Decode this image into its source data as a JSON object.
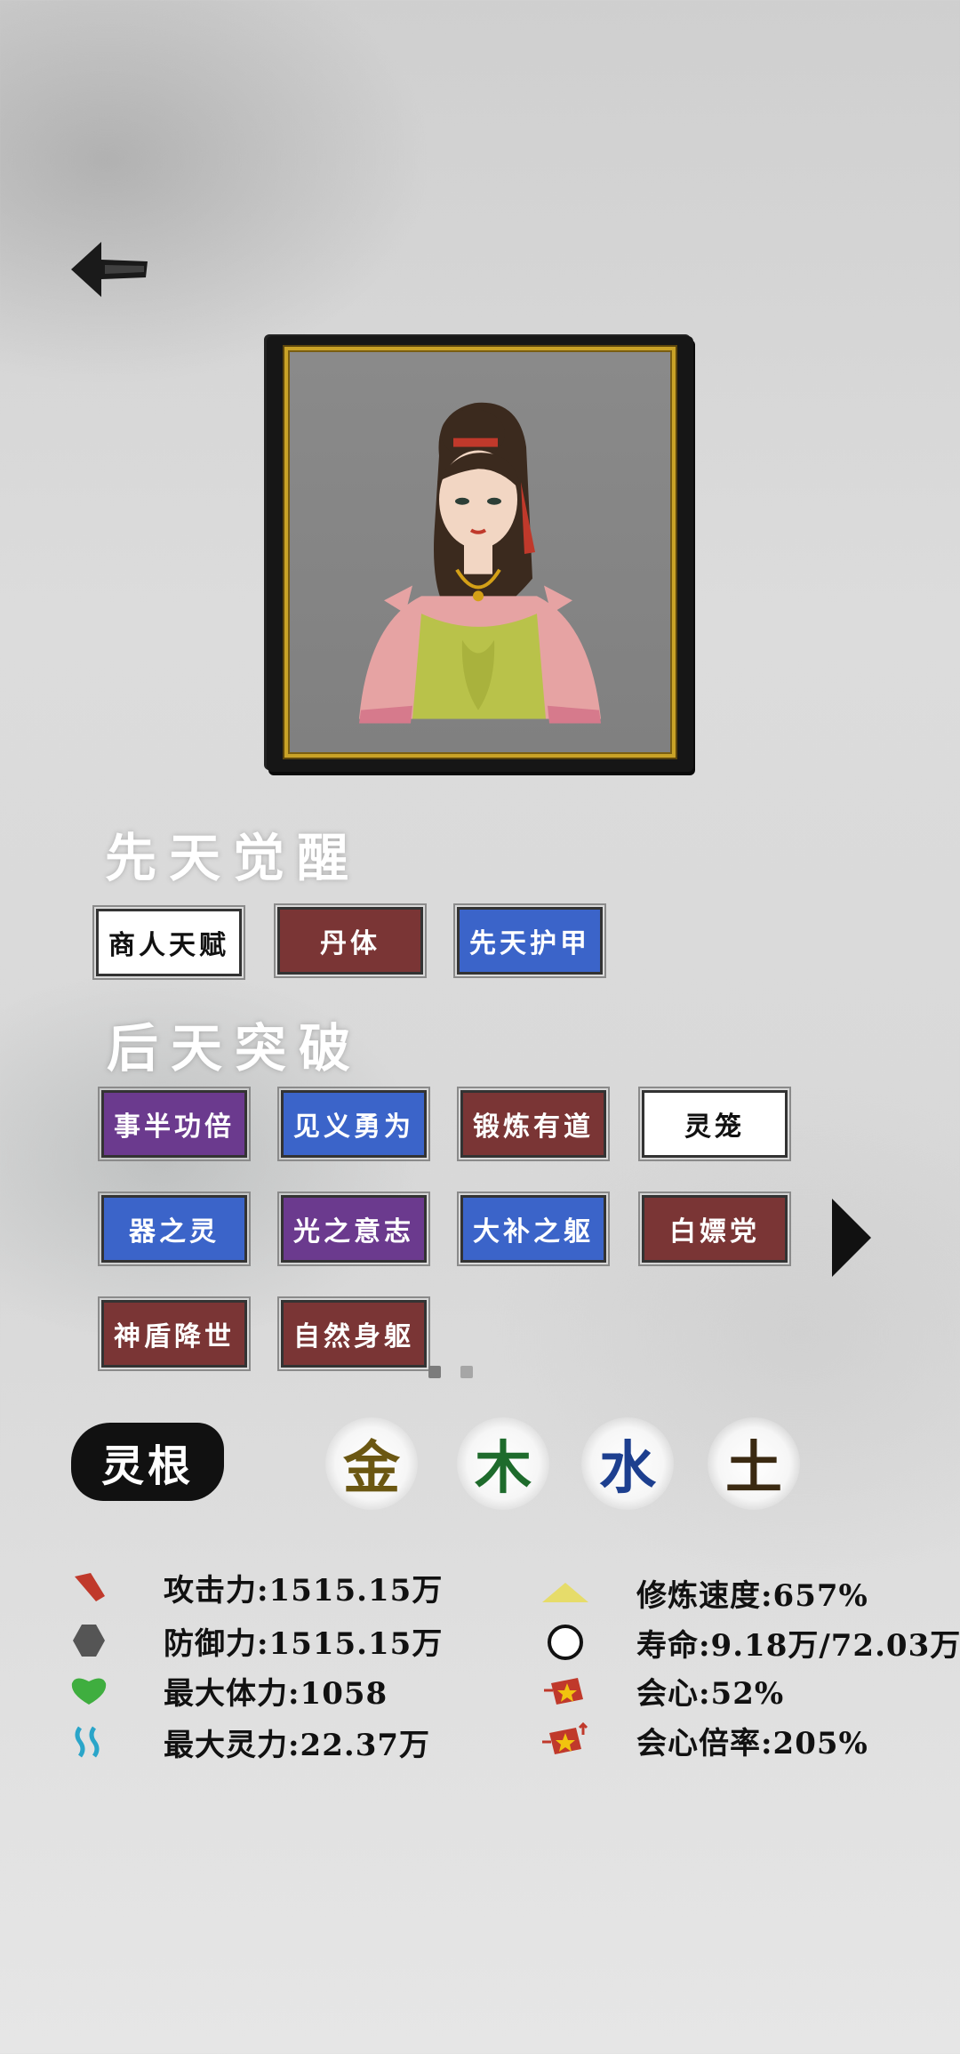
{
  "header": {
    "back_icon": "arrow-left-icon"
  },
  "innate": {
    "title": "先天觉醒",
    "tags": [
      {
        "label": "商人天赋",
        "color": "white"
      },
      {
        "label": "丹体",
        "color": "red"
      },
      {
        "label": "先天护甲",
        "color": "blue"
      }
    ]
  },
  "acquired": {
    "title": "后天突破",
    "tags": [
      {
        "label": "事半功倍",
        "color": "purple"
      },
      {
        "label": "见义勇为",
        "color": "blue"
      },
      {
        "label": "锻炼有道",
        "color": "red"
      },
      {
        "label": "灵笼",
        "color": "white"
      },
      {
        "label": "器之灵",
        "color": "blue"
      },
      {
        "label": "光之意志",
        "color": "purple"
      },
      {
        "label": "大补之躯",
        "color": "blue"
      },
      {
        "label": "白嫖党",
        "color": "red"
      },
      {
        "label": "神盾降世",
        "color": "red"
      },
      {
        "label": "自然身躯",
        "color": "red"
      }
    ]
  },
  "spirit_root": {
    "label": "灵根",
    "elements": [
      {
        "char": "金",
        "color": "#6b5712"
      },
      {
        "char": "木",
        "color": "#1e6b2c"
      },
      {
        "char": "水",
        "color": "#1d3f8f"
      },
      {
        "char": "土",
        "color": "#3b2a12"
      }
    ]
  },
  "stats": {
    "left": [
      {
        "icon": "attack-icon",
        "text": "攻击力:1515.15万"
      },
      {
        "icon": "defense-icon",
        "text": "防御力:1515.15万"
      },
      {
        "icon": "health-icon",
        "text": "最大体力:1058"
      },
      {
        "icon": "spirit-icon",
        "text": "最大灵力:22.37万"
      }
    ],
    "right": [
      {
        "icon": "cultivation-speed-icon",
        "text": "修炼速度:657%"
      },
      {
        "icon": "lifespan-icon",
        "text": "寿命:9.18万/72.03万"
      },
      {
        "icon": "critical-icon",
        "text": "会心:52%"
      },
      {
        "icon": "critical-multiplier-icon",
        "text": "会心倍率:205%"
      }
    ]
  },
  "colors": {
    "white": "#ffffff",
    "red": "#7a3535",
    "blue": "#3b64c9",
    "purple": "#6b3a8e"
  }
}
